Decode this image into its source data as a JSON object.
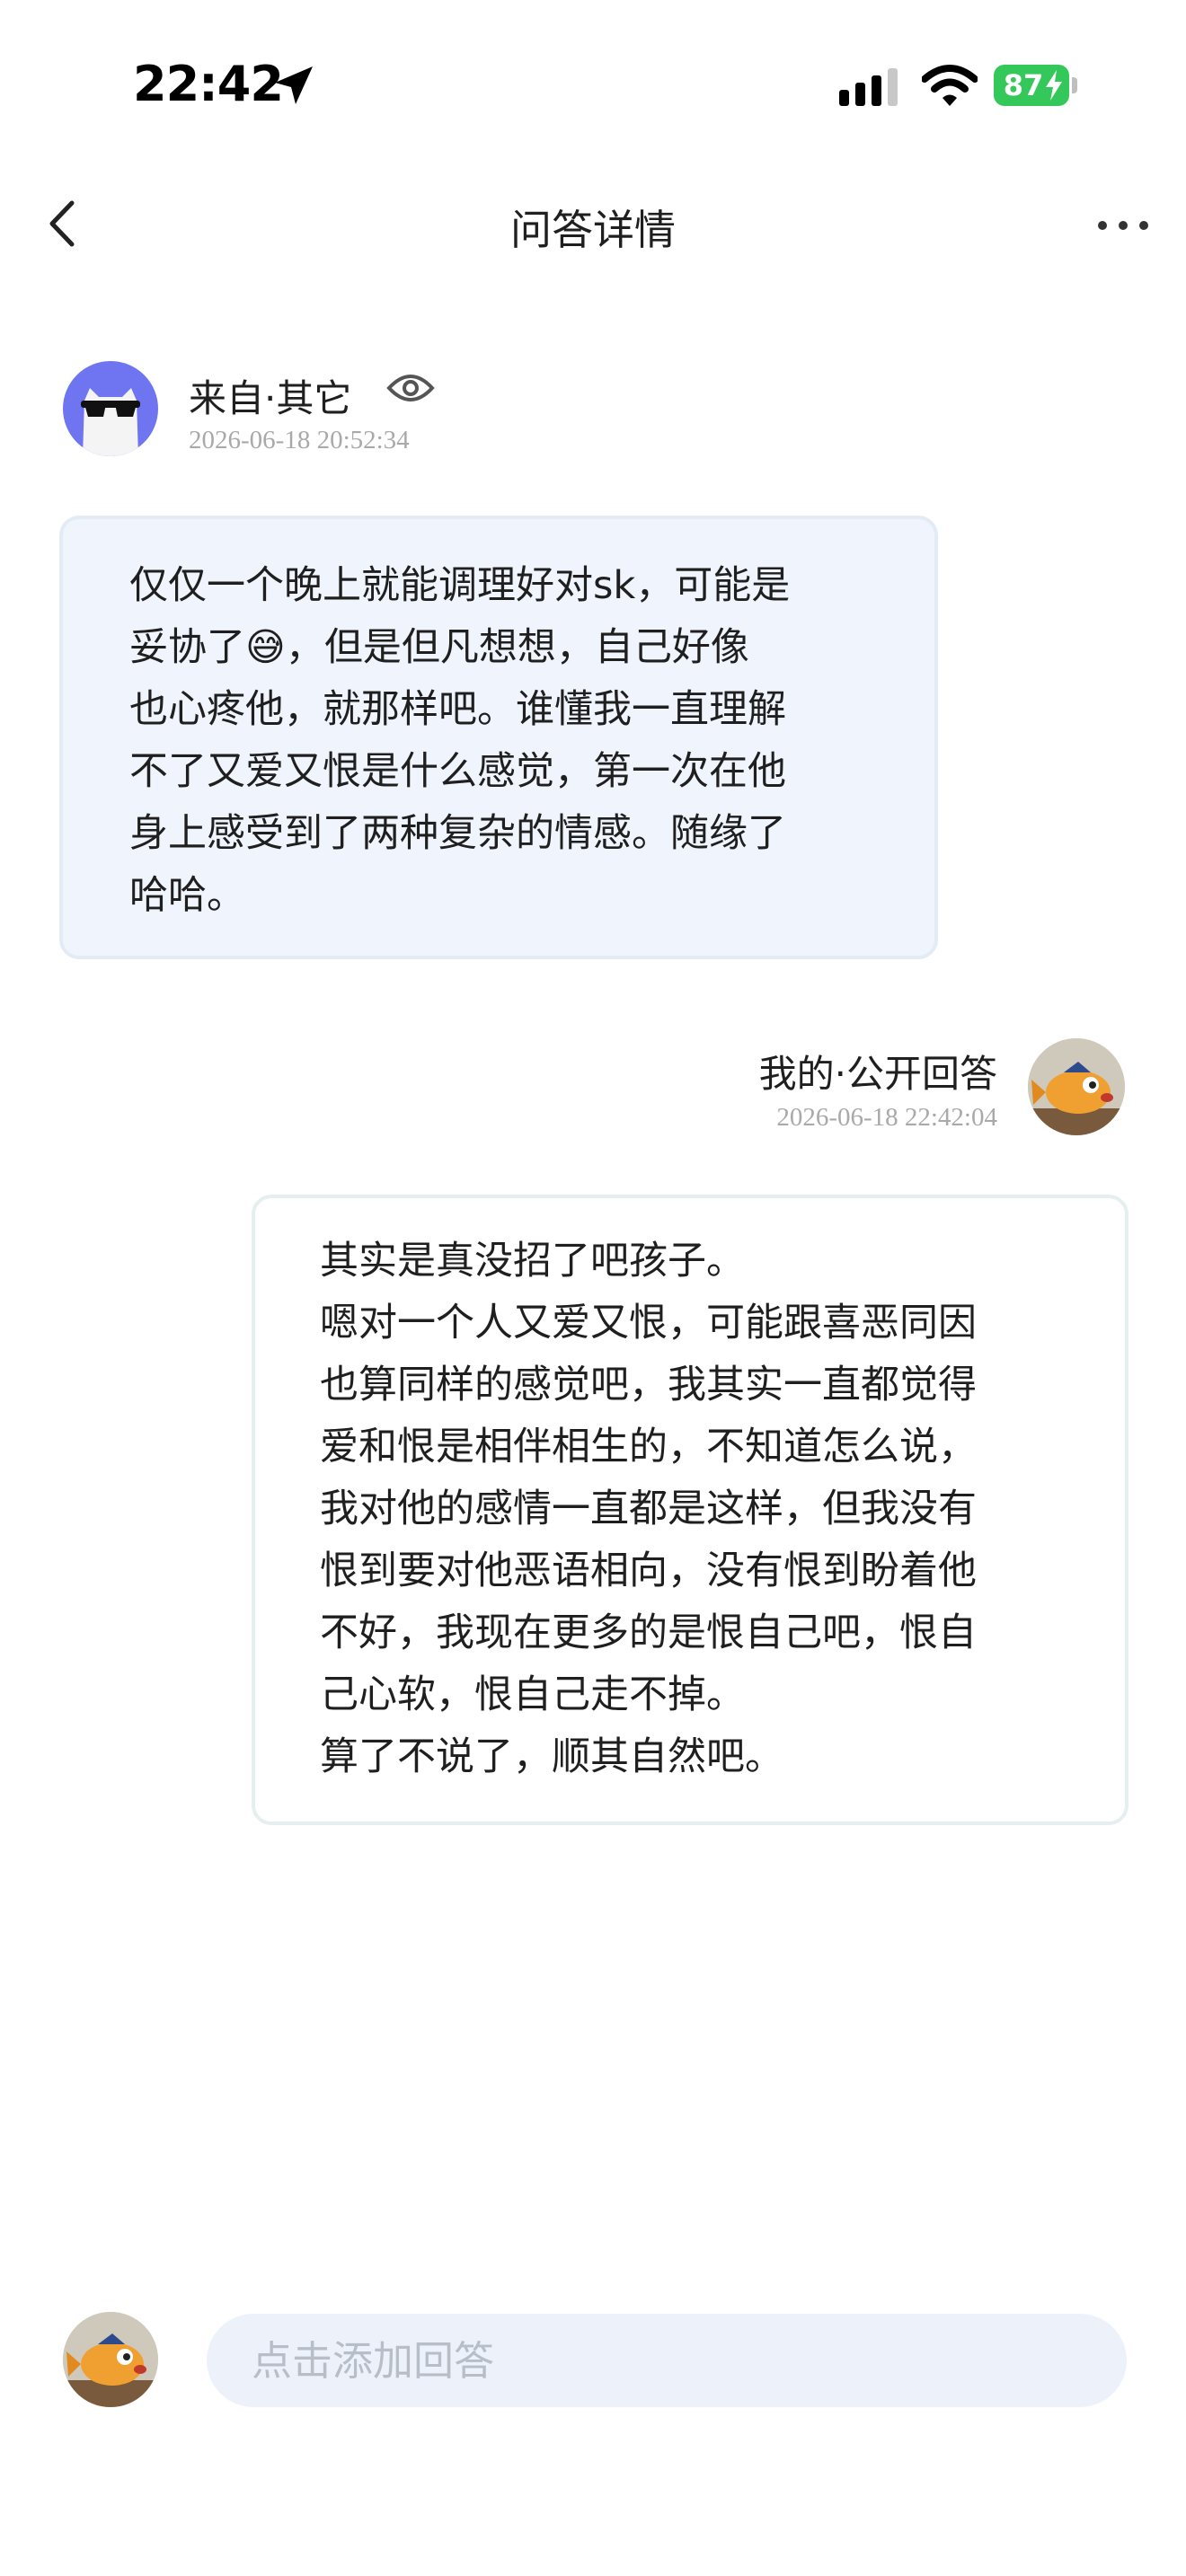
{
  "status_bar": {
    "time": "22:42",
    "battery": "87"
  },
  "nav": {
    "title": "问答详情"
  },
  "question": {
    "source": "来自·其它",
    "timestamp": "2026-06-18 20:52:34",
    "text": "仅仅一个晚上就能调理好对sk，可能是\n妥协了😅，但是但凡想想，自己好像\n也心疼他，就那样吧。谁懂我一直理解\n不了又爱又恨是什么感觉，第一次在他\n身上感受到了两种复杂的情感。随缘了\n哈哈。"
  },
  "answer": {
    "label": "我的·公开回答",
    "timestamp": "2026-06-18 22:42:04",
    "text": "其实是真没招了吧孩子。\n嗯对一个人又爱又恨，可能跟喜恶同因\n也算同样的感觉吧，我其实一直都觉得\n爱和恨是相伴相生的，不知道怎么说，\n我对他的感情一直都是这样，但我没有\n恨到要对他恶语相向，没有恨到盼着他\n不好，我现在更多的是恨自己吧，恨自\n己心软，恨自己走不掉。\n算了不说了，顺其自然吧。"
  },
  "reply": {
    "placeholder": "点击添加回答",
    "value": ""
  },
  "colors": {
    "accent_avatar": "#6f74f0",
    "question_bubble_bg": "#f0f5fd",
    "input_bg": "#edf2fa",
    "battery_green": "#34c759",
    "timestamp_gray": "#a9a9a9"
  },
  "icons": [
    "location-arrow-icon",
    "cellular-signal-icon",
    "wifi-icon",
    "battery-icon",
    "back-chevron-icon",
    "more-dots-icon",
    "eye-icon",
    "cat-sunglasses-avatar",
    "fish-avatar"
  ]
}
